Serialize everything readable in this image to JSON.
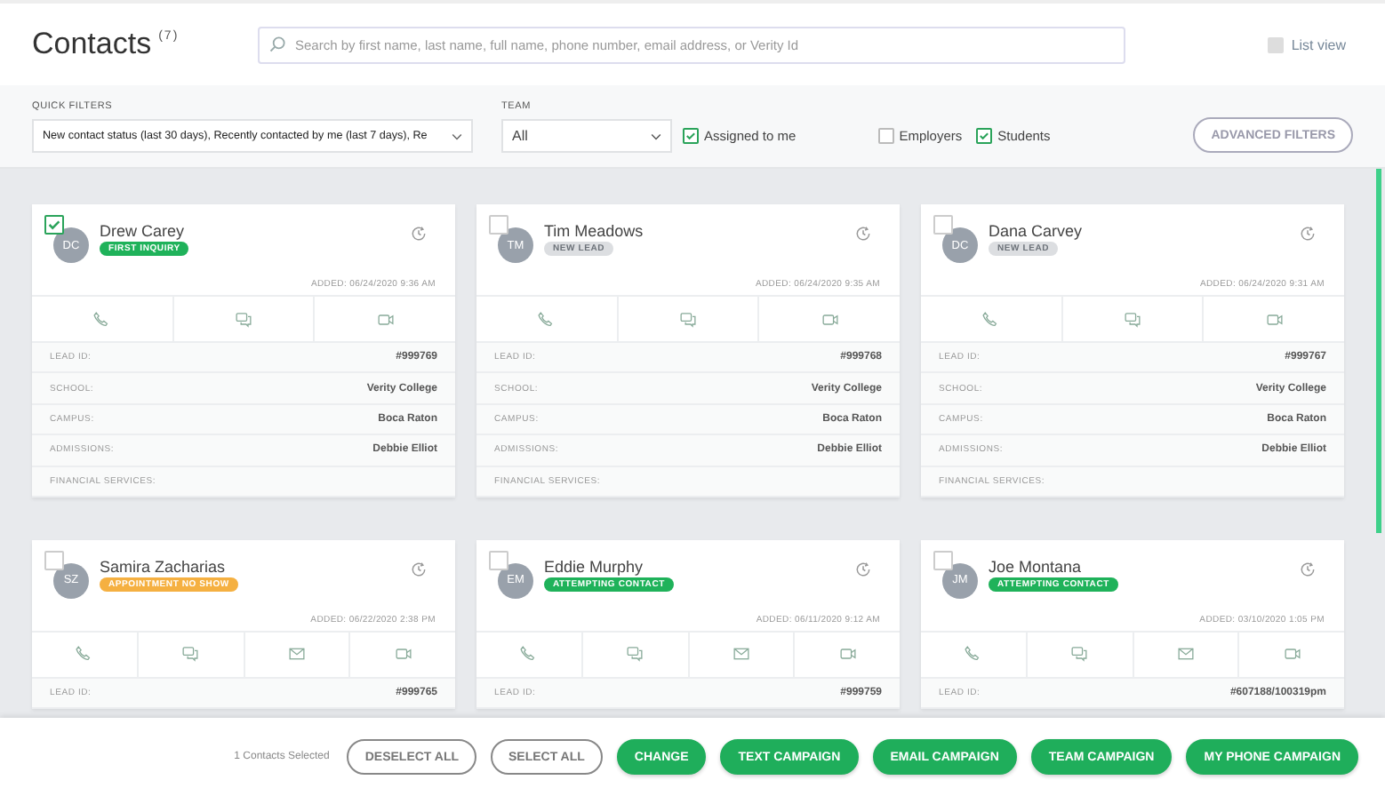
{
  "header": {
    "title": "Contacts",
    "count": "(7)",
    "search": {
      "placeholder": "Search by first name, last name, full name, phone number, email address, or Verity Id"
    },
    "list_view": {
      "label": "List view",
      "checked": false
    }
  },
  "filters": {
    "quick_filters": {
      "label": "QUICK FILTERS",
      "value": "New contact status (last 30 days), Recently contacted by me (last 7 days), Re"
    },
    "team": {
      "label": "TEAM",
      "value": "All"
    },
    "toggles": [
      {
        "label": "Assigned to me",
        "checked": true
      },
      {
        "label": "Employers",
        "checked": false
      },
      {
        "label": "Students",
        "checked": true
      }
    ],
    "advanced_button": "ADVANCED FILTERS"
  },
  "cards": [
    {
      "initials": "DC",
      "name": "Drew Carey",
      "status": {
        "label": "FIRST INQUIRY",
        "color": "#1fb25a"
      },
      "added": "ADDED: 06/24/2020 9:36 AM",
      "selected": true,
      "actions": [
        {
          "kind": "phone"
        },
        {
          "kind": "chat"
        },
        {
          "kind": "video"
        }
      ],
      "fields": [
        {
          "label": "LEAD ID:",
          "value": "#999769"
        },
        {
          "label": "SCHOOL:",
          "value": "Verity College"
        },
        {
          "label": "CAMPUS:",
          "value": "Boca Raton"
        },
        {
          "label": "ADMISSIONS:",
          "value": "Debbie Elliot"
        },
        {
          "label": "FINANCIAL SERVICES:"
        }
      ]
    },
    {
      "initials": "TM",
      "name": "Tim Meadows",
      "status": {
        "label": "NEW LEAD",
        "color": "#dcdee1"
      },
      "added": "ADDED: 06/24/2020 9:35 AM",
      "selected": false,
      "actions": [
        {
          "kind": "phone"
        },
        {
          "kind": "chat"
        },
        {
          "kind": "video"
        }
      ],
      "fields": [
        {
          "label": "LEAD ID:",
          "value": "#999768"
        },
        {
          "label": "SCHOOL:",
          "value": "Verity College"
        },
        {
          "label": "CAMPUS:",
          "value": "Boca Raton"
        },
        {
          "label": "ADMISSIONS:",
          "value": "Debbie Elliot"
        },
        {
          "label": "FINANCIAL SERVICES:"
        }
      ]
    },
    {
      "initials": "DC",
      "name": "Dana Carvey",
      "status": {
        "label": "NEW LEAD",
        "color": "#dcdee1"
      },
      "added": "ADDED: 06/24/2020 9:31 AM",
      "selected": false,
      "actions": [
        {
          "kind": "phone"
        },
        {
          "kind": "chat"
        },
        {
          "kind": "video"
        }
      ],
      "fields": [
        {
          "label": "LEAD ID:",
          "value": "#999767"
        },
        {
          "label": "SCHOOL:",
          "value": "Verity College"
        },
        {
          "label": "CAMPUS:",
          "value": "Boca Raton"
        },
        {
          "label": "ADMISSIONS:",
          "value": "Debbie Elliot"
        },
        {
          "label": "FINANCIAL SERVICES:"
        }
      ]
    },
    {
      "initials": "SZ",
      "name": "Samira Zacharias",
      "status": {
        "label": "APPOINTMENT NO SHOW",
        "color": "#f5b041"
      },
      "added": "ADDED: 06/22/2020 2:38 PM",
      "selected": false,
      "actions": [
        {
          "kind": "phone"
        },
        {
          "kind": "chat"
        },
        {
          "kind": "email"
        },
        {
          "kind": "video"
        }
      ],
      "fields": [
        {
          "label": "LEAD ID:",
          "value": "#999765"
        }
      ]
    },
    {
      "initials": "EM",
      "name": "Eddie Murphy",
      "status": {
        "label": "ATTEMPTING CONTACT",
        "color": "#1fb25a"
      },
      "added": "ADDED: 06/11/2020 9:12 AM",
      "selected": false,
      "actions": [
        {
          "kind": "phone"
        },
        {
          "kind": "chat"
        },
        {
          "kind": "email"
        },
        {
          "kind": "video"
        }
      ],
      "fields": [
        {
          "label": "LEAD ID:",
          "value": "#999759"
        }
      ]
    },
    {
      "initials": "JM",
      "name": "Joe Montana",
      "status": {
        "label": "ATTEMPTING CONTACT",
        "color": "#1fb25a"
      },
      "added": "ADDED: 03/10/2020 1:05 PM",
      "selected": false,
      "actions": [
        {
          "kind": "phone"
        },
        {
          "kind": "chat"
        },
        {
          "kind": "email"
        },
        {
          "kind": "video"
        }
      ],
      "fields": [
        {
          "label": "LEAD ID:",
          "value": "#607188/100319pm"
        }
      ]
    }
  ],
  "bottom_bar": {
    "selection": "1 Contacts Selected",
    "buttons": [
      {
        "label": "DESELECT ALL",
        "kind": "outline"
      },
      {
        "label": "SELECT ALL",
        "kind": "outline"
      },
      {
        "label": "CHANGE",
        "kind": "primary"
      },
      {
        "label": "TEXT CAMPAIGN",
        "kind": "primary"
      },
      {
        "label": "EMAIL CAMPAIGN",
        "kind": "primary"
      },
      {
        "label": "TEAM CAMPAIGN",
        "kind": "primary"
      },
      {
        "label": "MY PHONE CAMPAIGN",
        "kind": "primary"
      }
    ]
  }
}
